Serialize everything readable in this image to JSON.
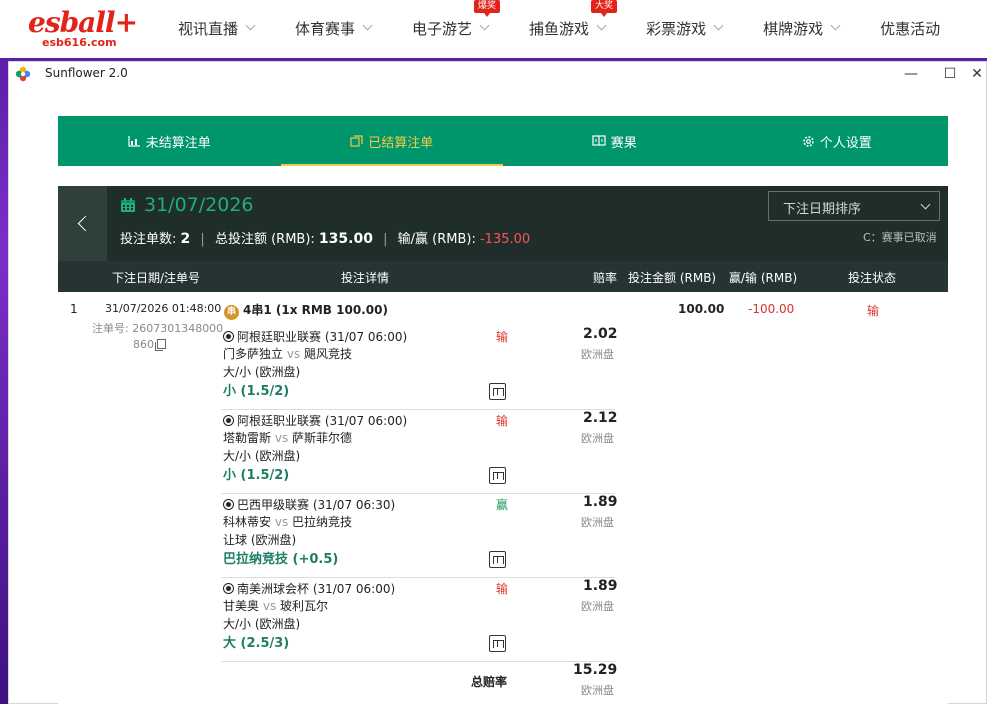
{
  "site": {
    "logo_main": "esball+",
    "logo_sub": "esb616.com",
    "nav": [
      {
        "label": "视讯直播",
        "badge": ""
      },
      {
        "label": "体育赛事",
        "badge": ""
      },
      {
        "label": "电子游艺",
        "badge": "爆奖"
      },
      {
        "label": "捕鱼游戏",
        "badge": "大奖"
      },
      {
        "label": "彩票游戏",
        "badge": ""
      },
      {
        "label": "棋牌游戏",
        "badge": ""
      },
      {
        "label": "优惠活动",
        "badge": ""
      }
    ]
  },
  "window": {
    "title": "Sunflower 2.0",
    "minimize": "—",
    "maximize": "☐",
    "close": "✕"
  },
  "tabs": [
    {
      "label": "未结算注单",
      "icon": "chart-icon"
    },
    {
      "label": "已结算注单",
      "icon": "settled-icon",
      "active": true
    },
    {
      "label": "赛果",
      "icon": "score-icon"
    },
    {
      "label": "个人设置",
      "icon": "gear-icon"
    }
  ],
  "panel": {
    "date": "31/07/2026",
    "count_label": "投注单数:",
    "count_value": "2",
    "total_label": "总投注额 (RMB):",
    "total_value": "135.00",
    "winloss_label": "输/赢 (RMB):",
    "winloss_value": "-135.00",
    "sort_select": "下注日期排序",
    "legend": "C：赛事已取消"
  },
  "columns": {
    "date_id": "下注日期/注单号",
    "detail": "投注详情",
    "odds": "赔率",
    "amount": "投注金额 (RMB)",
    "winloss": "赢/输 (RMB)",
    "status": "投注状态"
  },
  "bet": {
    "index": "1",
    "datetime": "31/07/2026 01:48:00",
    "id_line1": "注单号: 2607301348000",
    "id_line2": "860",
    "type_badge": "串",
    "type_label": "4串1 (1x RMB 100.00)",
    "amount": "100.00",
    "winloss": "-100.00",
    "status": "输",
    "legs": [
      {
        "league": "阿根廷职业联赛 (31/07 06:00)",
        "home": "门多萨独立",
        "vs": "vs",
        "away": "飓风竞技",
        "market": "大/小 (欧洲盘)",
        "selection": "小 (1.5/2)",
        "result": "输",
        "odds": "2.02",
        "odds_type": "欧洲盘"
      },
      {
        "league": "阿根廷职业联赛 (31/07 06:00)",
        "home": "塔勒雷斯",
        "vs": "vs",
        "away": "萨斯菲尔德",
        "market": "大/小 (欧洲盘)",
        "selection": "小 (1.5/2)",
        "result": "输",
        "odds": "2.12",
        "odds_type": "欧洲盘"
      },
      {
        "league": "巴西甲级联赛 (31/07 06:30)",
        "home": "科林蒂安",
        "vs": "vs",
        "away": "巴拉纳竞技",
        "market": "让球 (欧洲盘)",
        "selection": "巴拉纳竞技 (+0.5)",
        "result": "赢",
        "odds": "1.89",
        "odds_type": "欧洲盘"
      },
      {
        "league": "南美洲球会杯 (31/07 06:00)",
        "home": "甘美奥",
        "vs": "vs",
        "away": "玻利瓦尔",
        "market": "大/小 (欧洲盘)",
        "selection": "大 (2.5/3)",
        "result": "输",
        "odds": "1.89",
        "odds_type": "欧洲盘"
      }
    ],
    "total_odds_label": "总赔率",
    "total_odds": "15.29",
    "total_odds_type": "欧洲盘"
  },
  "colors": {
    "brand_red": "#e2231a",
    "tab_green": "#00966b",
    "header_dark": "#1f2d2b",
    "active_gold": "#f2c94c",
    "lose_red": "#d9342b",
    "win_green": "#1f9a5a",
    "selection_green": "#1f7d66"
  }
}
